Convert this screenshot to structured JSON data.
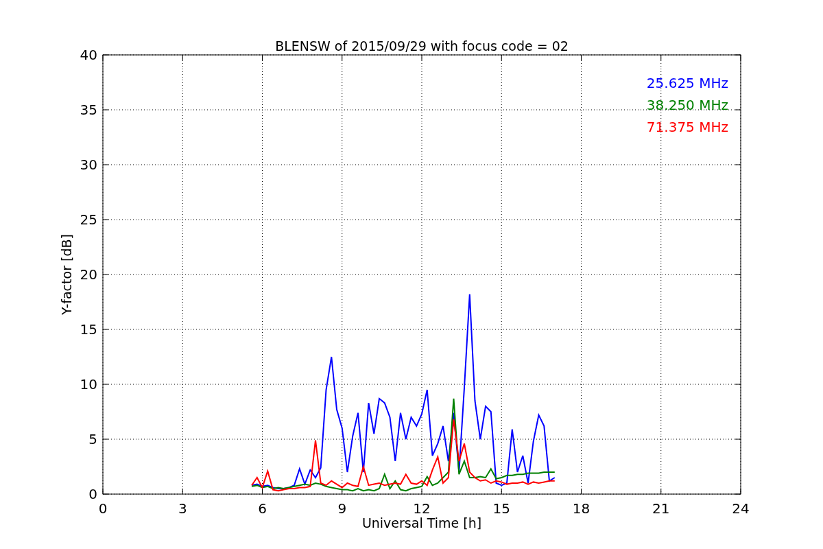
{
  "chart": {
    "chart_data": {
      "type": "line",
      "title": "BLENSW of 2015/09/29 with focus code = 02",
      "xlabel": "Universal Time [h]",
      "ylabel": "Y-factor [dB]",
      "x": [
        5.6,
        5.8,
        6.0,
        6.2,
        6.4,
        6.6,
        6.8,
        7.0,
        7.2,
        7.4,
        7.6,
        7.8,
        8.0,
        8.2,
        8.4,
        8.6,
        8.8,
        9.0,
        9.2,
        9.4,
        9.6,
        9.8,
        10.0,
        10.2,
        10.4,
        10.6,
        10.8,
        11.0,
        11.2,
        11.4,
        11.6,
        11.8,
        12.0,
        12.2,
        12.4,
        12.6,
        12.8,
        13.0,
        13.2,
        13.4,
        13.6,
        13.8,
        14.0,
        14.2,
        14.4,
        14.6,
        14.8,
        15.0,
        15.2,
        15.4,
        15.6,
        15.8,
        16.0,
        16.2,
        16.4,
        16.6,
        16.8,
        17.0
      ],
      "series": [
        {
          "name": "25.625 MHz",
          "color": "#0000ff",
          "values": [
            0.8,
            0.9,
            0.7,
            0.8,
            0.6,
            0.5,
            0.5,
            0.6,
            0.8,
            2.3,
            0.9,
            2.2,
            1.5,
            2.4,
            9.5,
            12.5,
            7.7,
            6.0,
            2.0,
            5.3,
            7.4,
            2.0,
            8.3,
            5.5,
            8.7,
            8.3,
            7.0,
            3.0,
            7.4,
            5.0,
            7.0,
            6.2,
            7.3,
            9.5,
            3.5,
            4.6,
            6.2,
            3.0,
            7.4,
            2.0,
            9.7,
            18.2,
            8.5,
            5.0,
            8.0,
            7.5,
            1.0,
            0.8,
            1.0,
            5.9,
            2.0,
            3.5,
            1.0,
            4.8,
            7.2,
            6.2,
            1.2,
            1.5
          ]
        },
        {
          "name": "38.250 MHz",
          "color": "#008000",
          "values": [
            0.7,
            0.8,
            0.6,
            0.7,
            0.5,
            0.6,
            0.5,
            0.6,
            0.7,
            0.8,
            0.9,
            0.8,
            1.0,
            0.9,
            0.7,
            0.6,
            0.5,
            0.4,
            0.4,
            0.3,
            0.5,
            0.3,
            0.4,
            0.3,
            0.5,
            1.8,
            0.5,
            1.2,
            0.4,
            0.3,
            0.5,
            0.6,
            0.7,
            1.6,
            0.8,
            1.0,
            1.5,
            2.0,
            8.7,
            1.8,
            3.0,
            1.5,
            1.5,
            1.6,
            1.5,
            2.3,
            1.4,
            1.5,
            1.7,
            1.7,
            1.8,
            1.8,
            1.9,
            1.9,
            1.9,
            2.0,
            2.0,
            2.0
          ]
        },
        {
          "name": "71.375 MHz",
          "color": "#ff0000",
          "values": [
            0.8,
            1.5,
            0.6,
            2.1,
            0.4,
            0.3,
            0.4,
            0.5,
            0.5,
            0.6,
            0.6,
            0.7,
            4.9,
            1.0,
            0.8,
            1.2,
            0.9,
            0.6,
            1.0,
            0.8,
            0.7,
            2.5,
            0.8,
            0.9,
            1.0,
            0.8,
            0.9,
            1.0,
            0.9,
            1.8,
            1.0,
            0.9,
            1.2,
            0.8,
            2.2,
            3.4,
            1.0,
            1.5,
            6.8,
            3.0,
            4.6,
            2.0,
            1.5,
            1.2,
            1.3,
            1.0,
            1.2,
            1.1,
            0.9,
            1.0,
            1.0,
            1.1,
            0.9,
            1.1,
            1.0,
            1.1,
            1.2,
            1.2
          ]
        }
      ],
      "xlim": [
        0,
        24
      ],
      "ylim": [
        0,
        40
      ],
      "xticks": [
        0,
        3,
        6,
        9,
        12,
        15,
        18,
        21,
        24
      ],
      "yticks": [
        0,
        5,
        10,
        15,
        20,
        25,
        30,
        35,
        40
      ],
      "grid": true
    }
  }
}
